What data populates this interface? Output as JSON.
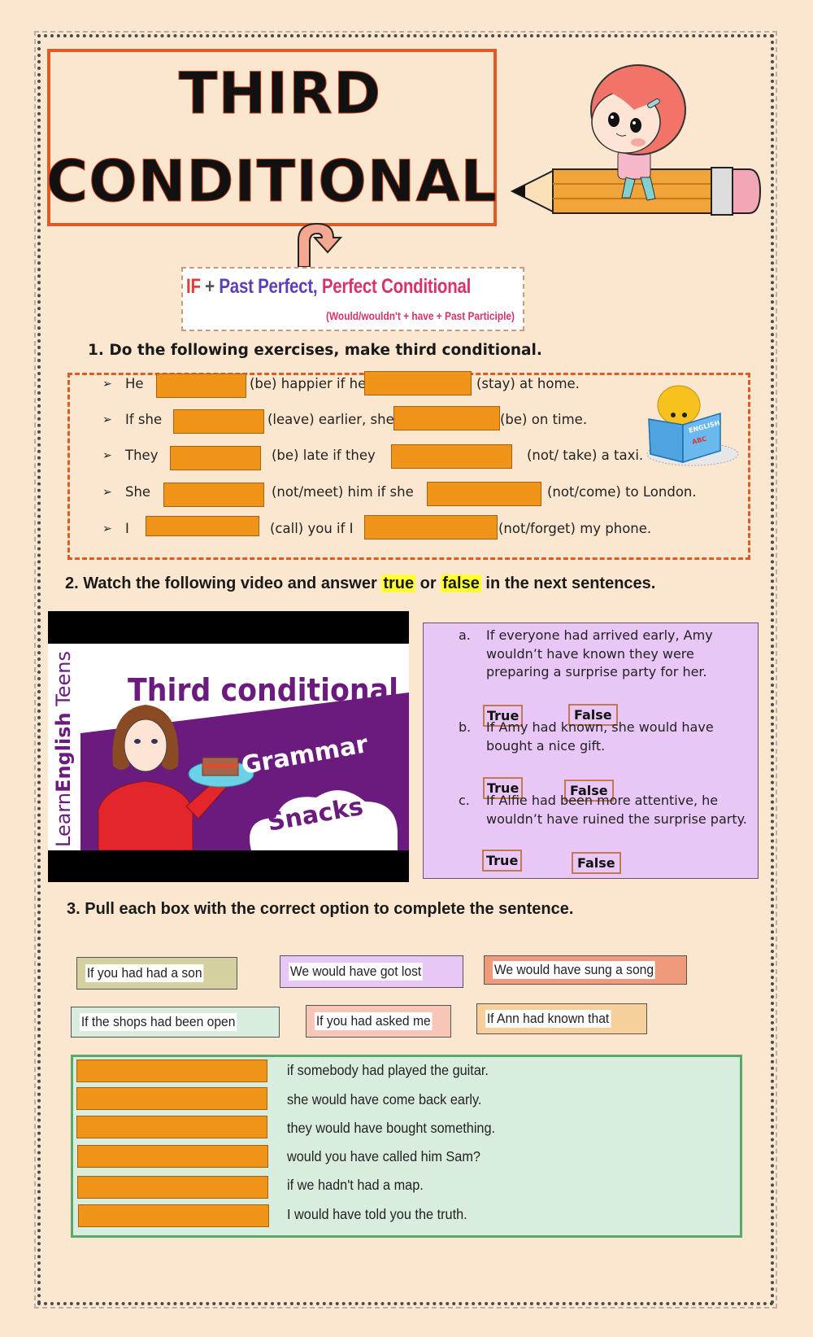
{
  "title": {
    "line1": "THIRD",
    "line2": "CONDITIONAL"
  },
  "formula": {
    "if": "IF",
    "plus": " + ",
    "past_perfect": "Past Perfect,",
    "perfect_conditional": " Perfect Conditional",
    "subtitle": "(Would/wouldn't + have + Past Participle)"
  },
  "section1": {
    "heading": "1.  Do the following exercises, make third conditional.",
    "bullet": "➢",
    "rows": [
      {
        "subject": "He",
        "mid": "(be) happier if he",
        "end": "(stay) at home."
      },
      {
        "subject": "If she",
        "mid": "(leave) earlier, she",
        "end": "(be) on time."
      },
      {
        "subject": "They",
        "mid": "(be) late if they",
        "end": "(not/ take) a taxi."
      },
      {
        "subject": "She",
        "mid": "(not/meet) him if she",
        "end": "(not/come) to London."
      },
      {
        "subject": "I",
        "mid": "(call) you if I",
        "end": "(not/forget) my phone."
      }
    ],
    "reader_book": {
      "line1": "ENGLISH",
      "line2": "ABC"
    }
  },
  "section2": {
    "heading_pre": "2. Watch  the following video and answer ",
    "heading_true": "true",
    "heading_or": " or ",
    "heading_false": "false",
    "heading_post": " in the next sentences.",
    "video": {
      "brand_learn": "Learn",
      "brand_english": "English",
      "brand_teens": " Teens",
      "title": "Third conditional",
      "tag1": "Grammar",
      "tag2": "Snacks"
    },
    "questions": [
      {
        "letter": "a.",
        "text": "If everyone had arrived early, Amy\nwouldn’t have known they were\npreparing a surprise party for her.",
        "true_label": "True",
        "false_label": "False"
      },
      {
        "letter": "b.",
        "text": "If Amy  had known, she  would  have\nbought  a nice gift.",
        "true_label": "True",
        "false_label": "False"
      },
      {
        "letter": "c.",
        "text": "If Alfie had been more attentive, he\nwouldn’t have ruined the surprise party.",
        "true_label": "True",
        "false_label": "False"
      }
    ]
  },
  "section3": {
    "heading": "3.  Pull each box with the correct option to complete the sentence.",
    "options": [
      {
        "text": "If you had had a son",
        "color": "#d5d0a0"
      },
      {
        "text": "We would have got lost",
        "color": "#e8c7f6"
      },
      {
        "text": "We would have sung a song",
        "color": "#ef9a7a"
      },
      {
        "text": "If the shops had been open",
        "color": "#d9eddf"
      },
      {
        "text": "If you had asked me",
        "color": "#f8c6b6"
      },
      {
        "text": "If Ann had known that",
        "color": "#f6cf9a"
      }
    ],
    "sentences": [
      "if somebody had played the guitar.",
      "she would have come back early.",
      "they would have bought something.",
      "would you have called him Sam?",
      "if we hadn't had a map.",
      "I would have told you the truth."
    ]
  }
}
